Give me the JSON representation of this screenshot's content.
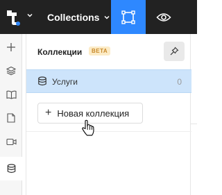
{
  "topbar": {
    "collections_label": "Collections",
    "frame_icon": "frame-select-icon",
    "eye_icon": "eye-icon",
    "colors": {
      "bg": "#222222",
      "active_tool": "#2e88ff"
    }
  },
  "rail": {
    "items": [
      {
        "icon": "plus-icon"
      },
      {
        "icon": "layers-icon"
      },
      {
        "icon": "book-icon"
      },
      {
        "icon": "page-icon"
      },
      {
        "icon": "video-icon"
      },
      {
        "icon": "database-icon",
        "active": true
      }
    ]
  },
  "panel": {
    "title": "Коллекции",
    "badge": "BETA",
    "pin_icon": "pin-icon",
    "collections": [
      {
        "name": "Услуги",
        "count": "0",
        "selected": true
      }
    ],
    "new_collection_label": "Новая коллекция"
  }
}
